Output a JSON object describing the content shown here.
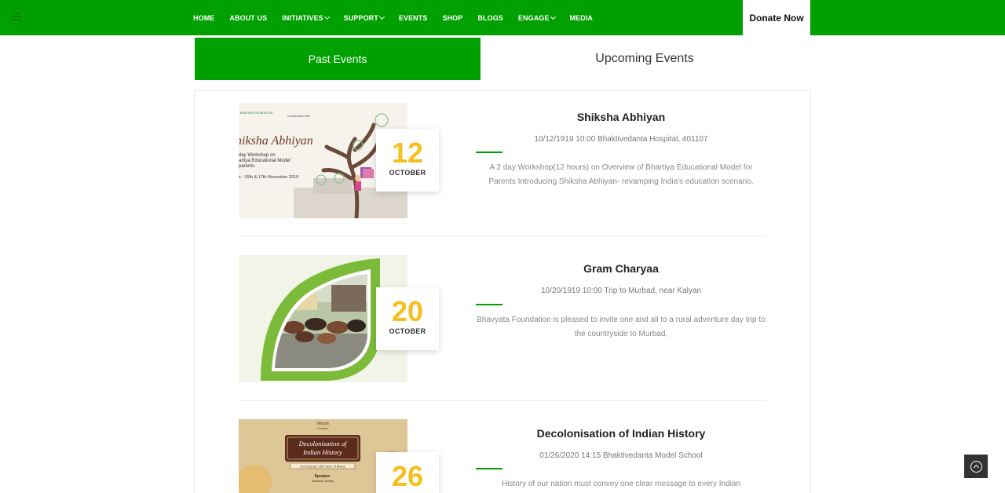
{
  "nav": {
    "items": [
      {
        "label": "HOME",
        "dropdown": false
      },
      {
        "label": "ABOUT US",
        "dropdown": false
      },
      {
        "label": "INITIATIVES",
        "dropdown": true
      },
      {
        "label": "SUPPORT",
        "dropdown": true
      },
      {
        "label": "EVENTS",
        "dropdown": false
      },
      {
        "label": "SHOP",
        "dropdown": false
      },
      {
        "label": "BLOGS",
        "dropdown": false
      },
      {
        "label": "ENGAGE",
        "dropdown": true
      },
      {
        "label": "MEDIA",
        "dropdown": false
      }
    ],
    "donate_label": "Donate Now"
  },
  "tabs": {
    "past": "Past Events",
    "upcoming": "Upcoming Events"
  },
  "events": [
    {
      "title": "Shiksha Abhiyan",
      "day": "12",
      "month": "OCTOBER",
      "meta": "10/12/1919 10:00 Bhaktivedanta Hospital, 401107",
      "description": "A 2 day Workshop(12 hours) on Overview of Bhartiya Educational Model for Parents Introducing Shiksha Abhiyan- revamping India's education scenario.",
      "poster": {
        "heading": "hiksha Abhiyan",
        "sub1": "day Workshop on",
        "sub2": "artiya Educational Model",
        "sub3": "parents.",
        "dates": "s : 16th & 17th November 2019",
        "org": "BHAVYATA FOUNDATION",
        "partner": "In association with"
      }
    },
    {
      "title": "Gram Charyaa",
      "day": "20",
      "month": "OCTOBER",
      "meta": "10/20/1919 10:00 Trip to Murbad, near Kalyan",
      "description": "Bhavyata Foundation is pleased to invite one and all to a rural adventure day trip to the countryside to Murbad,"
    },
    {
      "title": "Decolonisation of Indian History",
      "day": "26",
      "month": "",
      "meta": "01/26/2020 14:15 Bhaktivedanta Model School",
      "description": "History of our nation must convey one clear message to every Indian",
      "poster": {
        "heading1": "Decolonisation of",
        "heading2": "Indian History",
        "sub": "Decoding last 1300 Years Of Bharat",
        "speaker_label": "Speaker:",
        "speaker_name": "Sandeep Shetty",
        "presenter": "Nimyth",
        "presents": "Presents"
      }
    }
  ],
  "colors": {
    "brand_green": "#00a000",
    "date_yellow": "#f4c01e"
  },
  "icons": {
    "menu": "hamburger-menu-icon",
    "scroll_top": "chevron-up-circle-icon"
  }
}
